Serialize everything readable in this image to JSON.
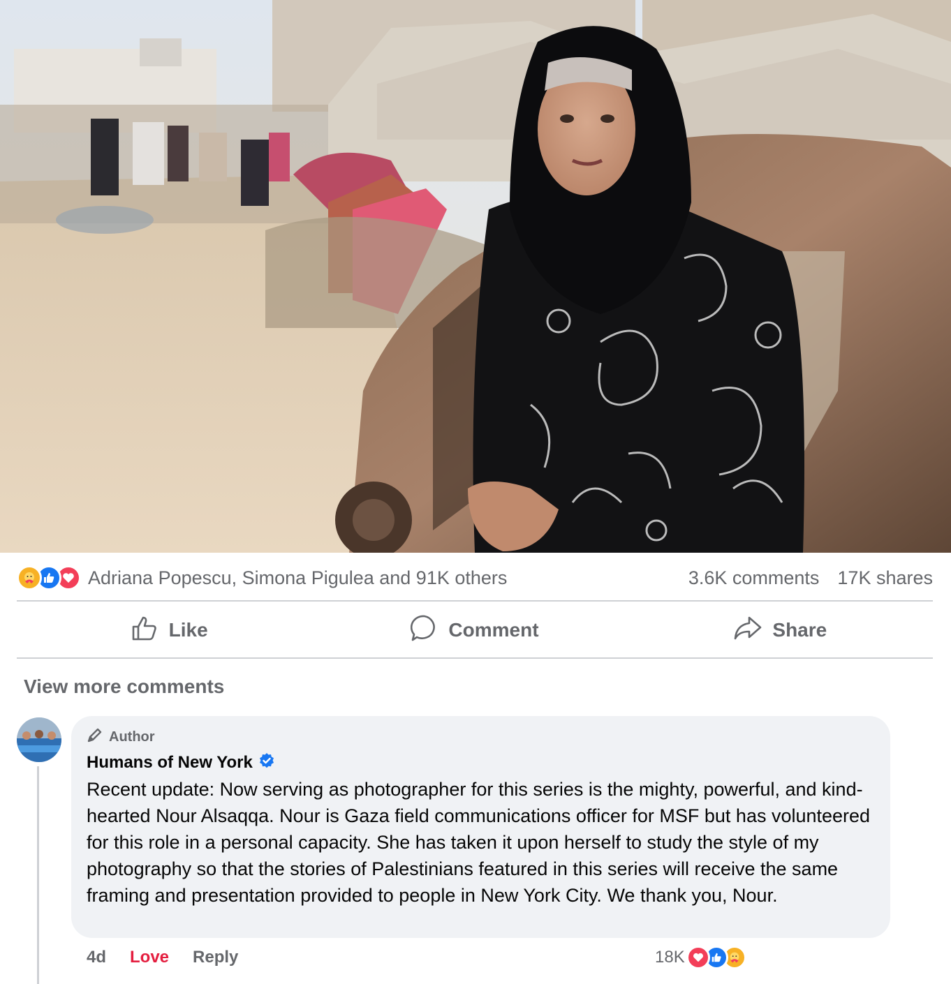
{
  "post": {
    "photo_alt": "Woman in black hijab and paisley dress standing beside a burned car",
    "reactions_summary": "Adriana Popescu, Simona Pigulea and 91K others",
    "comments_count": "3.6K comments",
    "shares_count": "17K shares"
  },
  "actions": {
    "like": "Like",
    "comment": "Comment",
    "share": "Share"
  },
  "view_more": "View more comments",
  "comment": {
    "badge": "Author",
    "author": "Humans of New York",
    "text": "Recent update: Now serving as photographer for this series is the mighty, powerful, and kind-hearted Nour Alsaqqa. Nour is Gaza field communications officer for MSF but has volunteered for this role in a personal capacity. She has taken it upon herself to study the style of my photography so that the stories of Palestinians featured in this series will receive the same framing and presentation provided to people in New York City. We thank you, Nour.",
    "time": "4d",
    "love_label": "Love",
    "reply_label": "Reply",
    "reaction_count": "18K"
  },
  "colors": {
    "like_blue": "#1877f2",
    "love_red": "#f33e58",
    "care_yellow": "#f7b125",
    "secondary_text": "#65676b",
    "bubble_bg": "#f0f2f5"
  }
}
